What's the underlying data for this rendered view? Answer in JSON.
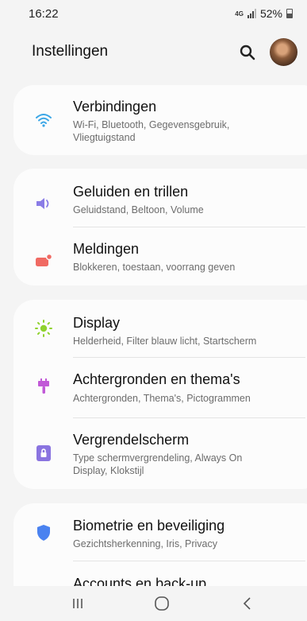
{
  "status_bar": {
    "time": "16:22",
    "network_top": "4G",
    "network_bottom": "+†",
    "battery": "52%"
  },
  "header": {
    "title": "Instellingen",
    "search_icon": "search-icon",
    "avatar": "profile-avatar"
  },
  "colors": {
    "connections": "#3aa6e6",
    "sounds": "#8a7ce6",
    "notifications": "#f06a63",
    "display": "#8fd22e",
    "wallpapers": "#c159d7",
    "lockscreen": "#8a74e0",
    "biometrics": "#4a82f0",
    "accounts": "#f5a623"
  },
  "sections": [
    {
      "items": [
        {
          "icon": "wifi-icon",
          "title": "Verbindingen",
          "subtitle": "Wi-Fi, Bluetooth, Gegevensgebruik, Vliegtuigstand"
        }
      ]
    },
    {
      "items": [
        {
          "icon": "volume-icon",
          "title": "Geluiden en trillen",
          "subtitle": "Geluidstand, Beltoon, Volume"
        },
        {
          "icon": "notification-icon",
          "title": "Meldingen",
          "subtitle": "Blokkeren, toestaan, voorrang geven"
        }
      ]
    },
    {
      "items": [
        {
          "icon": "brightness-icon",
          "title": "Display",
          "subtitle": "Helderheid, Filter blauw licht, Startscherm"
        },
        {
          "icon": "paintbrush-icon",
          "title": "Achtergronden en thema's",
          "subtitle": "Achtergronden, Thema's, Pictogrammen"
        },
        {
          "icon": "lock-icon",
          "title": "Vergrendelscherm",
          "subtitle": "Type schermvergrendeling, Always On Display, Klokstijl"
        }
      ]
    },
    {
      "items": [
        {
          "icon": "shield-icon",
          "title": "Biometrie en beveiliging",
          "subtitle": "Gezichtsherkenning, Iris, Privacy"
        },
        {
          "icon": "key-icon",
          "title": "Accounts en back-up",
          "subtitle": ""
        }
      ]
    }
  ],
  "nav": {
    "recents": "recents-icon",
    "home": "home-icon",
    "back": "back-icon"
  }
}
